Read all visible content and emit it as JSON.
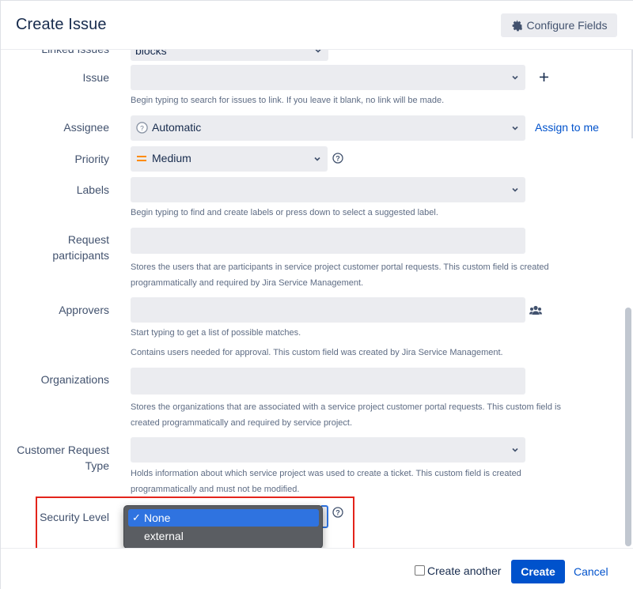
{
  "header": {
    "title": "Create Issue",
    "configure_label": "Configure Fields"
  },
  "fields": {
    "linked_issues": {
      "label": "Linked Issues",
      "value": "blocks"
    },
    "issue": {
      "label": "Issue",
      "help": "Begin typing to search for issues to link. If you leave it blank, no link will be made."
    },
    "assignee": {
      "label": "Assignee",
      "value": "Automatic",
      "assign_link": "Assign to me"
    },
    "priority": {
      "label": "Priority",
      "value": "Medium",
      "color": "#ff8b00"
    },
    "labels": {
      "label": "Labels",
      "help": "Begin typing to find and create labels or press down to select a suggested label."
    },
    "request_participants": {
      "label_line1": "Request",
      "label_line2": "participants",
      "help_line1": "Stores the users that are participants in service project customer portal requests. This custom field is created",
      "help_line2": "programmatically and required by Jira Service Management."
    },
    "approvers": {
      "label": "Approvers",
      "help_line1": "Start typing to get a list of possible matches.",
      "help_line2": "Contains users needed for approval. This custom field was created by Jira Service Management."
    },
    "organizations": {
      "label": "Organizations",
      "help_line1": "Stores the organizations that are associated with a service project customer portal requests. This custom field is",
      "help_line2": "created programmatically and required by service project."
    },
    "customer_request_type": {
      "label_line1": "Customer Request",
      "label_line2": "Type",
      "help_line1": "Holds information about which service project was used to create a ticket. This custom field is created",
      "help_line2": "programmatically and must not be modified."
    },
    "security_level": {
      "label": "Security Level",
      "options": [
        {
          "label": "None",
          "selected": true,
          "check": "✓"
        },
        {
          "label": "external",
          "selected": false
        }
      ]
    }
  },
  "footer": {
    "create_another_label": "Create another",
    "create_label": "Create",
    "cancel_label": "Cancel"
  },
  "colors": {
    "primary": "#0052cc",
    "highlight": "#e3241b",
    "dropdown_selected": "#2f73e0"
  }
}
